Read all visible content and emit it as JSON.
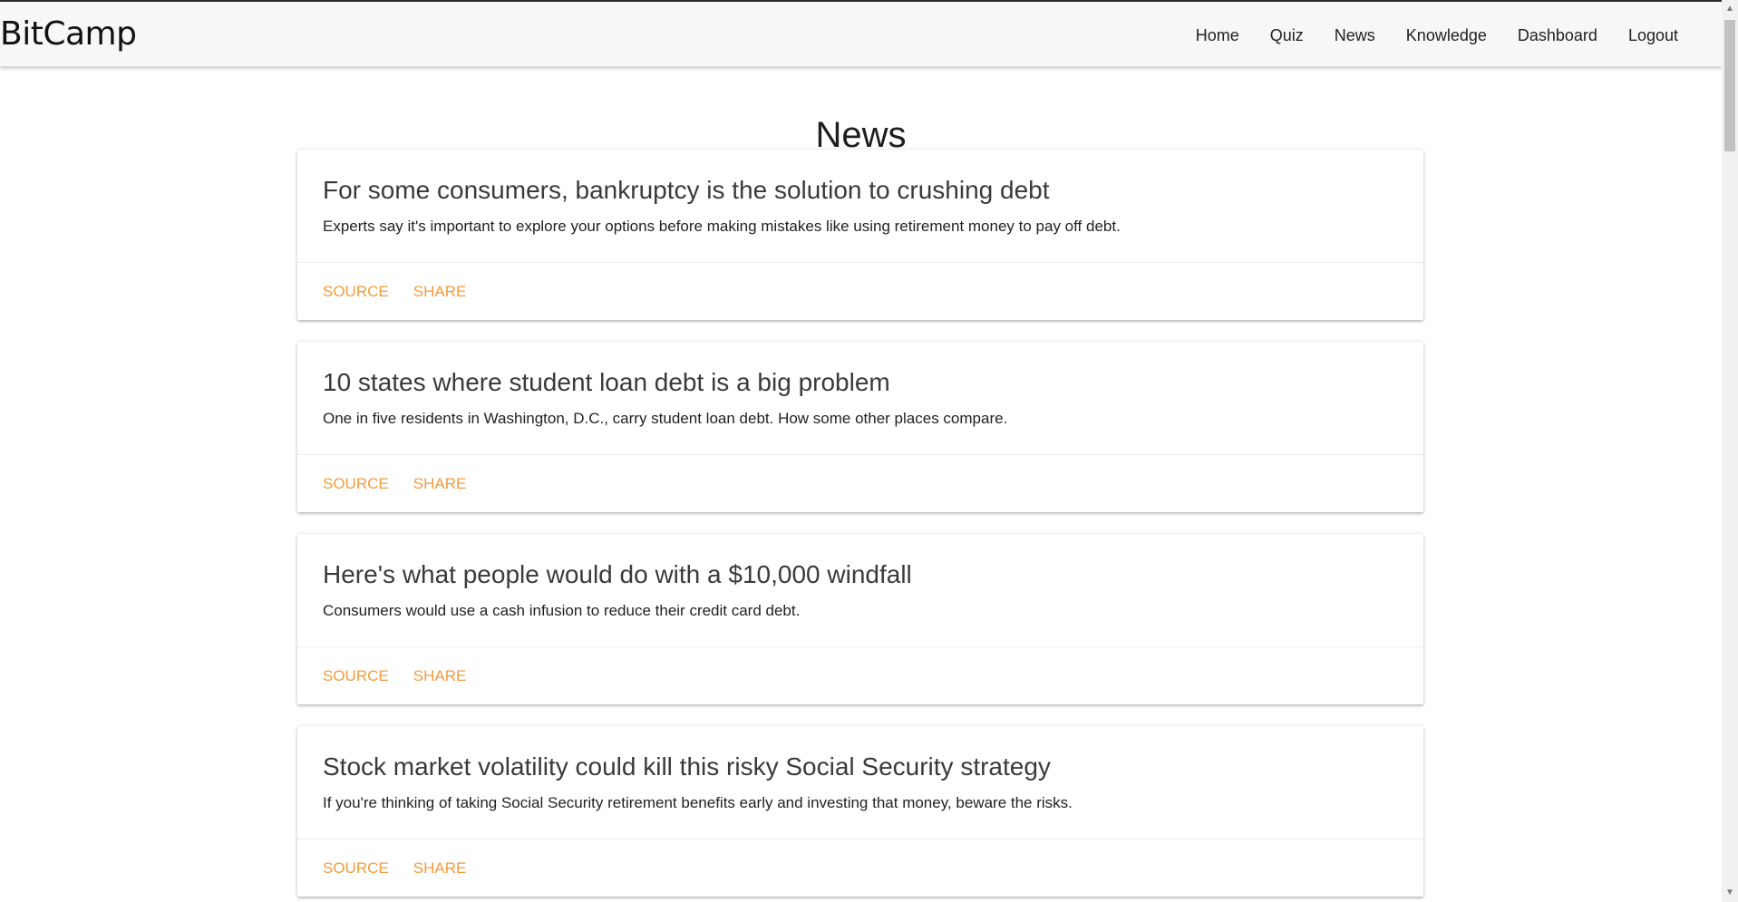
{
  "brand": "BitCamp",
  "nav": {
    "home": "Home",
    "quiz": "Quiz",
    "news": "News",
    "knowledge": "Knowledge",
    "dashboard": "Dashboard",
    "logout": "Logout"
  },
  "page_title": "News",
  "articles": [
    {
      "title": "For some consumers, bankruptcy is the solution to crushing debt",
      "summary": "Experts say it's important to explore your options before making mistakes like using retirement money to pay off debt.",
      "source_label": "SOURCE",
      "share_label": "SHARE"
    },
    {
      "title": "10 states where student loan debt is a big problem",
      "summary": "One in five residents in Washington, D.C., carry student loan debt. How some other places compare.",
      "source_label": "SOURCE",
      "share_label": "SHARE"
    },
    {
      "title": "Here's what people would do with a $10,000 windfall",
      "summary": "Consumers would use a cash infusion to reduce their credit card debt.",
      "source_label": "SOURCE",
      "share_label": "SHARE"
    },
    {
      "title": "Stock market volatility could kill this risky Social Security strategy",
      "summary": "If you're thinking of taking Social Security retirement benefits early and investing that money, beware the risks.",
      "source_label": "SOURCE",
      "share_label": "SHARE"
    }
  ],
  "colors": {
    "accent": "#f29b3b",
    "navbar_bg": "#f7f7f7"
  },
  "icons": {
    "scroll_up": "scroll-up-arrow-icon",
    "scroll_down": "scroll-down-arrow-icon"
  }
}
